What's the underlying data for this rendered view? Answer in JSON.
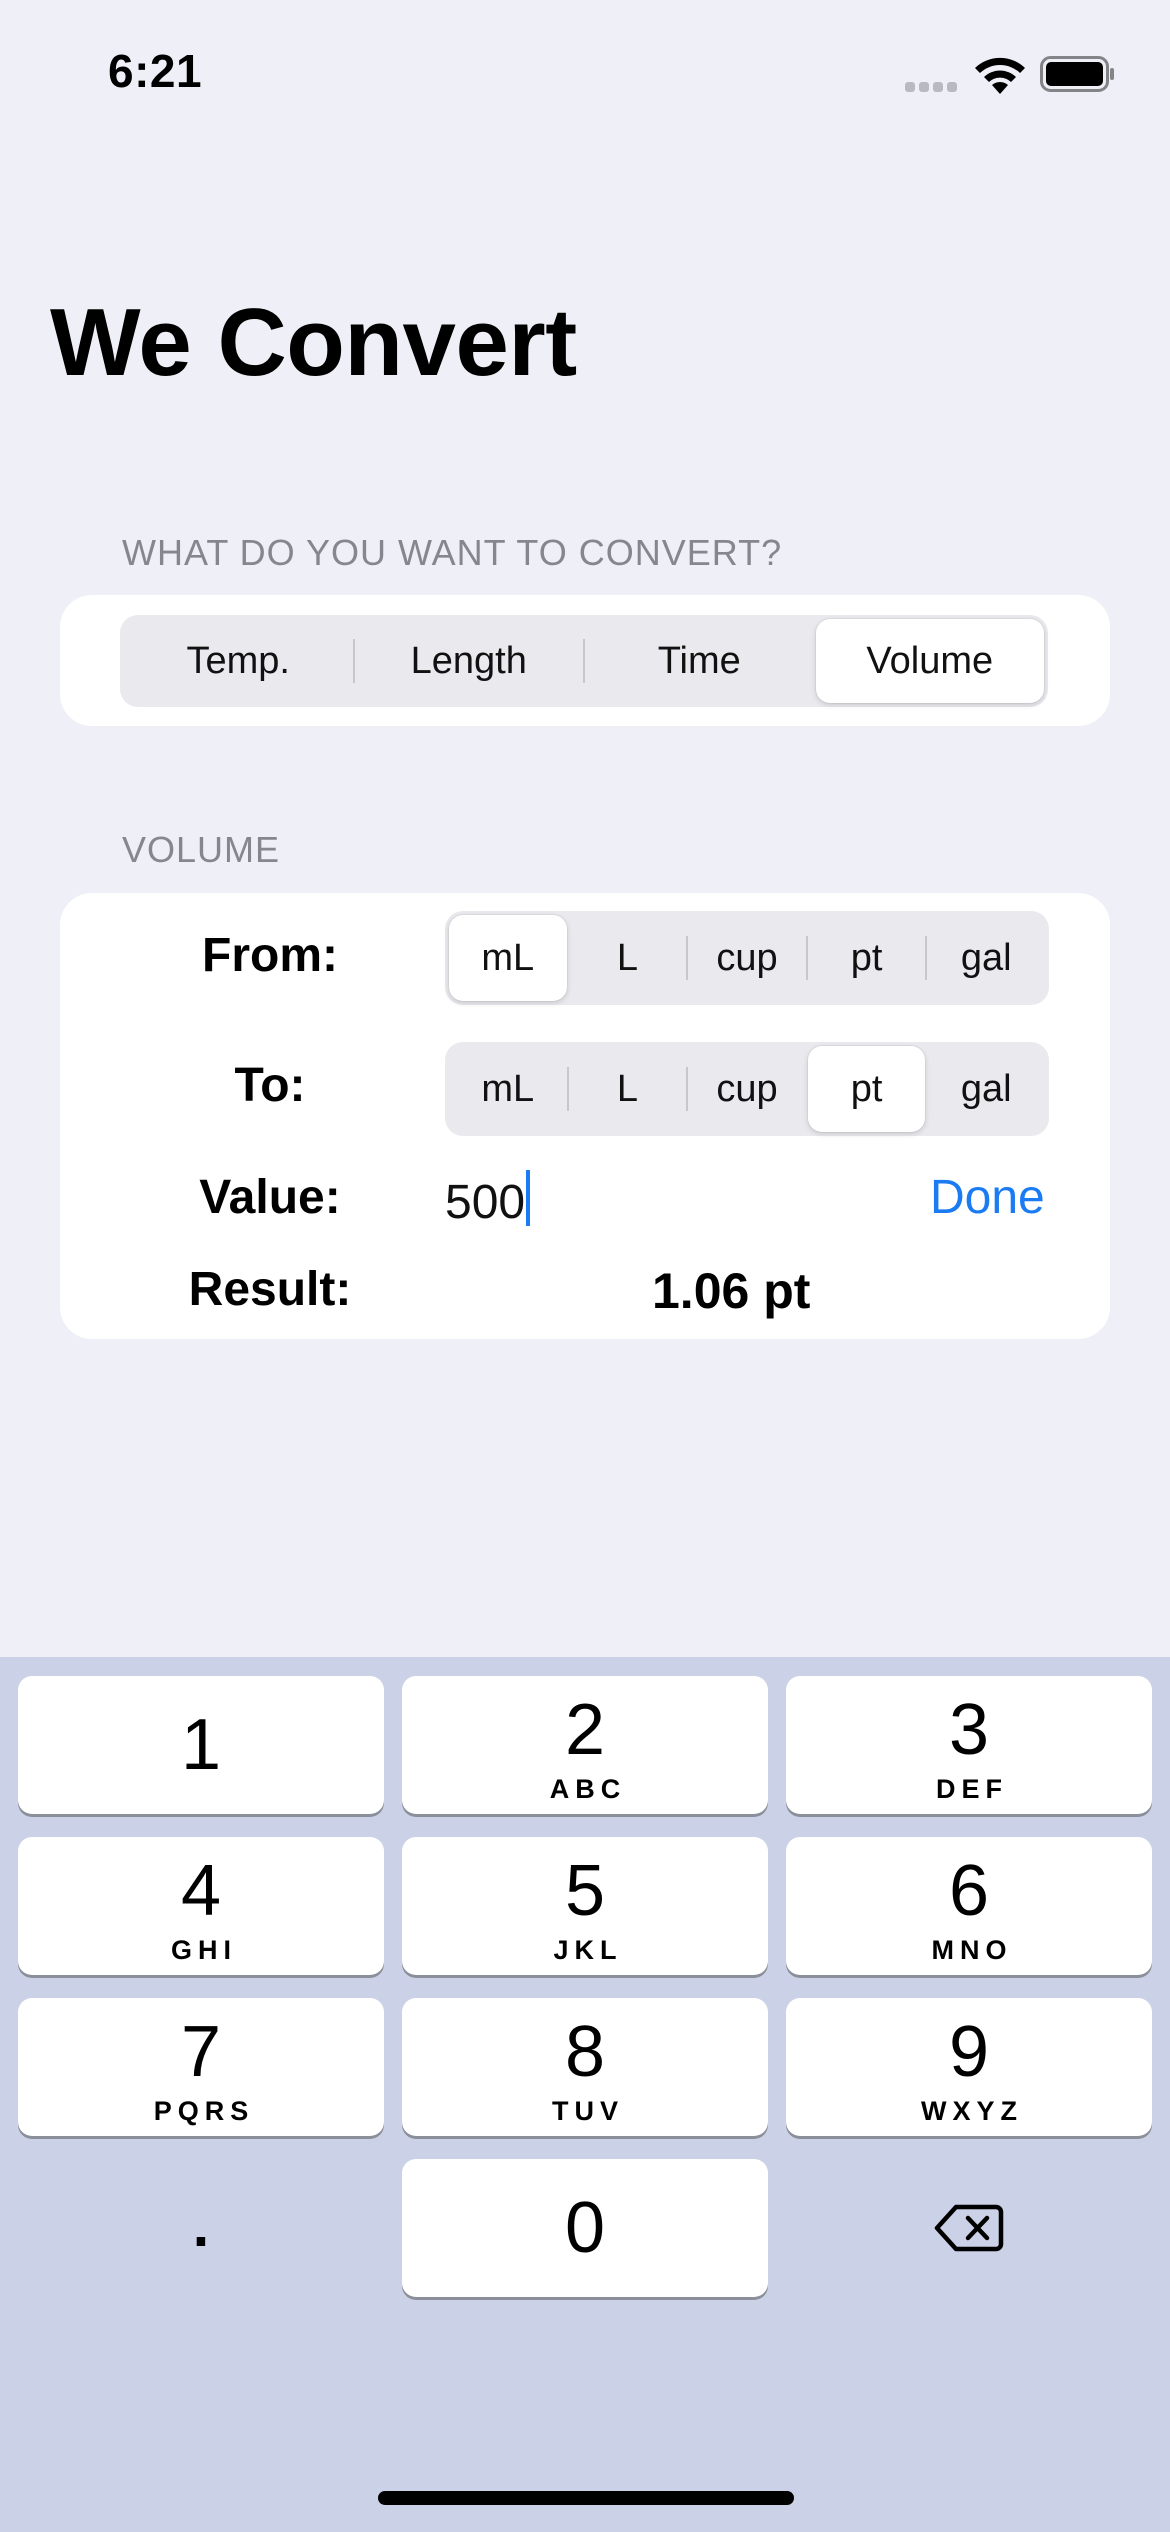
{
  "status_bar": {
    "time": "6:21"
  },
  "title": "We Convert",
  "conversion_section": {
    "header": "WHAT DO YOU WANT TO CONVERT?",
    "options": [
      "Temp.",
      "Length",
      "Time",
      "Volume"
    ],
    "selected": "Volume"
  },
  "volume_section": {
    "header": "VOLUME",
    "from_label": "From:",
    "to_label": "To:",
    "value_label": "Value:",
    "result_label": "Result:",
    "units": [
      "mL",
      "L",
      "cup",
      "pt",
      "gal"
    ],
    "from_selected": "mL",
    "to_selected": "pt",
    "value": "500",
    "done_label": "Done",
    "result": "1.06 pt"
  },
  "keyboard": {
    "keys": [
      {
        "digit": "1",
        "letters": ""
      },
      {
        "digit": "2",
        "letters": "ABC"
      },
      {
        "digit": "3",
        "letters": "DEF"
      },
      {
        "digit": "4",
        "letters": "GHI"
      },
      {
        "digit": "5",
        "letters": "JKL"
      },
      {
        "digit": "6",
        "letters": "MNO"
      },
      {
        "digit": "7",
        "letters": "PQRS"
      },
      {
        "digit": "8",
        "letters": "TUV"
      },
      {
        "digit": "9",
        "letters": "WXYZ"
      },
      {
        "digit": "0",
        "letters": ""
      }
    ],
    "decimal": ".",
    "delete_icon": "delete-left-icon"
  },
  "colors": {
    "accent": "#1a7bf2",
    "background": "#efeff7",
    "keyboard_bg": "#cbd1e6"
  }
}
